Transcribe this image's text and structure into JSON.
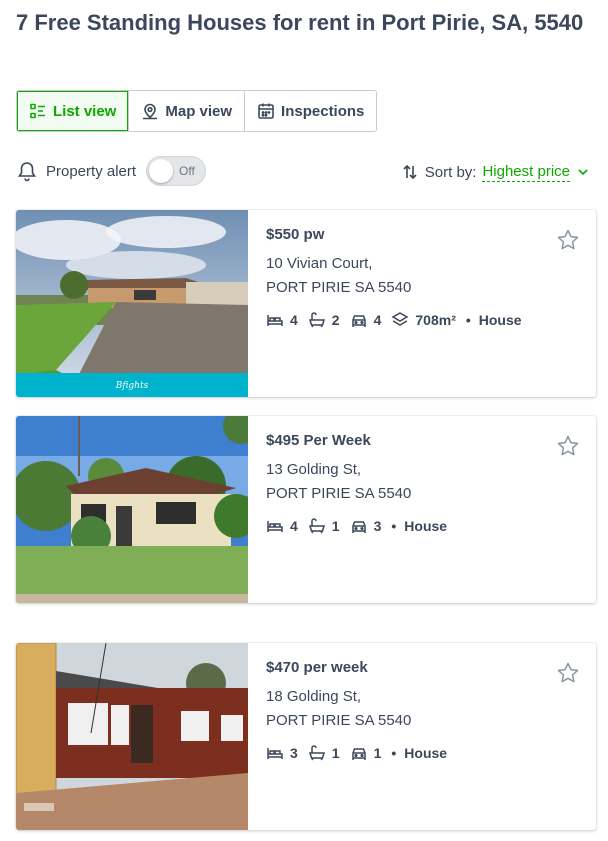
{
  "page": {
    "title": "7 Free Standing Houses for rent in Port Pirie, SA, 5540"
  },
  "view_tabs": [
    {
      "label": "List view",
      "icon": "list-icon",
      "active": true
    },
    {
      "label": "Map view",
      "icon": "map-pin-icon",
      "active": false
    },
    {
      "label": "Inspections",
      "icon": "calendar-icon",
      "active": false
    }
  ],
  "alert": {
    "label": "Property alert",
    "toggle_label": "Off",
    "enabled": false
  },
  "sort": {
    "label": "Sort by:",
    "value": "Highest price"
  },
  "listings": [
    {
      "price": "$550 pw",
      "address_line1": "10 Vivian Court,",
      "address_line2": "PORT PIRIE SA 5540",
      "beds": "4",
      "baths": "2",
      "parking": "4",
      "land_size": "708m²",
      "type": "House",
      "agency_mark": "Bfights"
    },
    {
      "price": "$495 Per Week",
      "address_line1": "13 Golding St,",
      "address_line2": "PORT PIRIE SA 5540",
      "beds": "4",
      "baths": "1",
      "parking": "3",
      "type": "House"
    },
    {
      "price": "$470 per week",
      "address_line1": "18 Golding St,",
      "address_line2": "PORT PIRIE SA 5540",
      "beds": "3",
      "baths": "1",
      "parking": "1",
      "type": "House"
    }
  ],
  "colors": {
    "accent": "#0ea800",
    "text": "#3c475b",
    "border": "#c8ccd2",
    "agency_band": "#00b3cc"
  }
}
